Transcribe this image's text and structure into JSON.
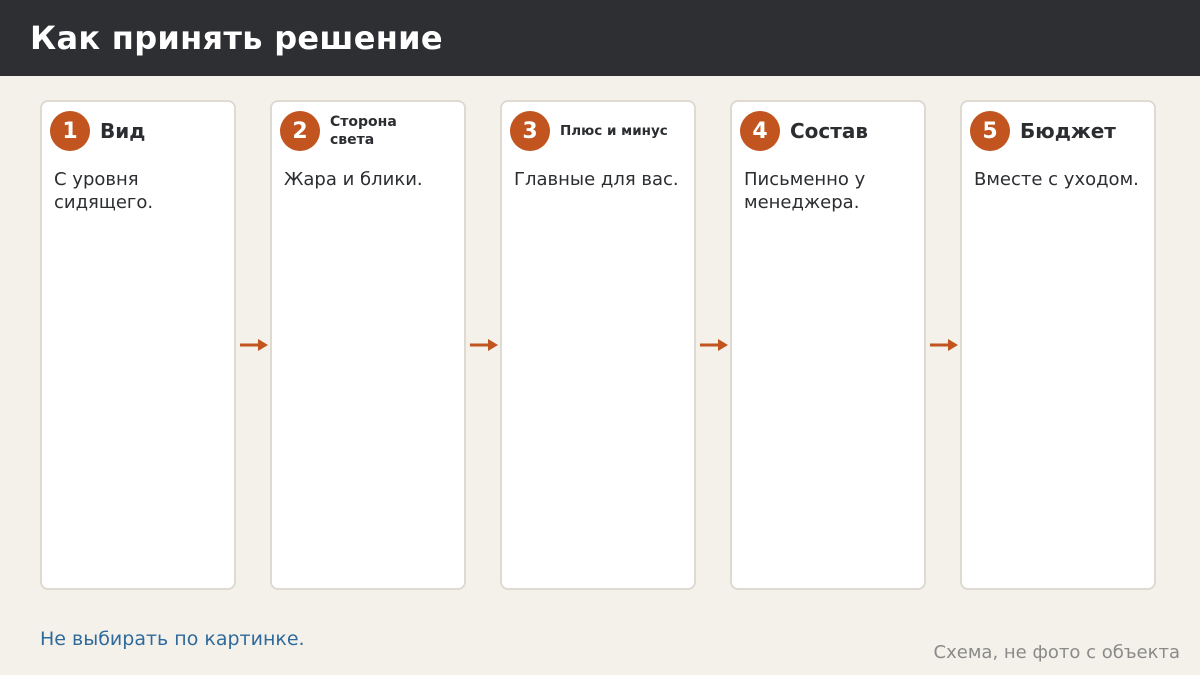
{
  "header": {
    "title": "Как принять решение"
  },
  "steps": [
    {
      "number": "1",
      "title": "Вид",
      "description": "С уровня сидящего."
    },
    {
      "number": "2",
      "title": "Сторона света",
      "description": "Жара и блики."
    },
    {
      "number": "3",
      "title": "Плюс и минус",
      "description": "Главные для вас."
    },
    {
      "number": "4",
      "title": "Состав",
      "description": "Письменно у менеджера."
    },
    {
      "number": "5",
      "title": "Бюджет",
      "description": "Вместе с уходом."
    }
  ],
  "footer": {
    "note": "Не выбирать по картинке.",
    "caption": "Схема, не фото с объекта"
  },
  "colors": {
    "header_bg": "#2d2f33",
    "accent": "#c1541f",
    "note_link": "#2f6a9a",
    "page_bg": "#f4f1eb"
  }
}
